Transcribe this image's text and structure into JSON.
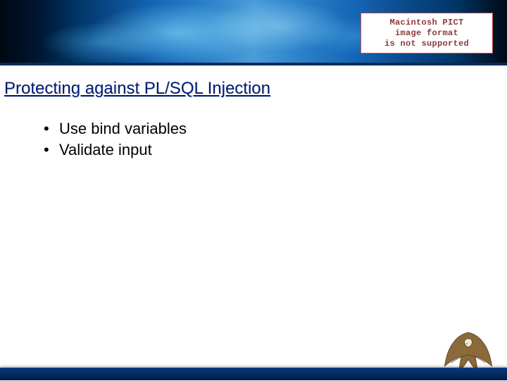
{
  "pict": {
    "line1": "Macintosh PICT",
    "line2": "image format",
    "line3": "is not supported"
  },
  "title": "Protecting against PL/SQL Injection",
  "bullets": [
    "Use bind variables",
    "Validate input"
  ]
}
